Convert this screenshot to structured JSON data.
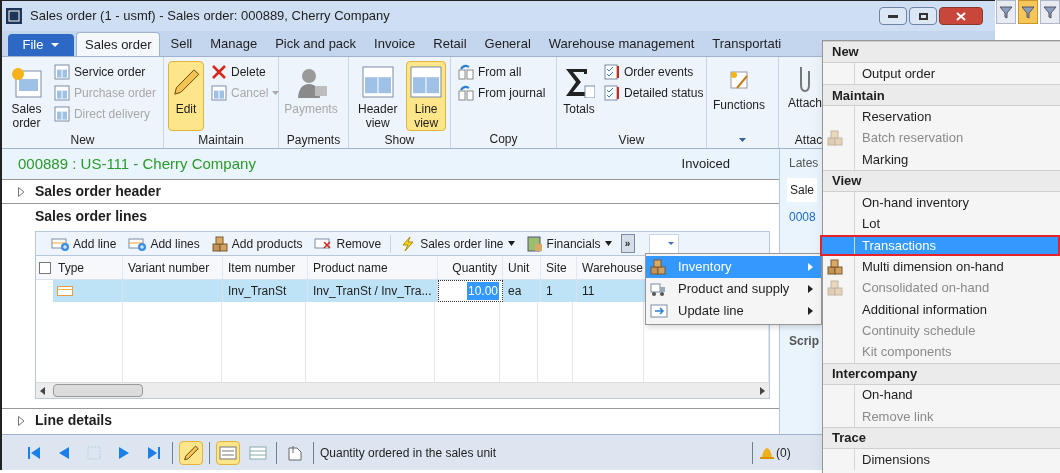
{
  "window": {
    "title": "Sales order (1 - usmf) - Sales order: 000889, Cherry Company"
  },
  "file_menu": {
    "label": "File"
  },
  "tabs": [
    {
      "label": "Sales order",
      "selected": true
    },
    {
      "label": "Sell",
      "selected": false
    },
    {
      "label": "Manage",
      "selected": false
    },
    {
      "label": "Pick and pack",
      "selected": false
    },
    {
      "label": "Invoice",
      "selected": false
    },
    {
      "label": "Retail",
      "selected": false
    },
    {
      "label": "General",
      "selected": false
    },
    {
      "label": "Warehouse management",
      "selected": false
    },
    {
      "label": "Transportati",
      "selected": false
    }
  ],
  "ribbon": [
    {
      "label": "New",
      "buttons": [
        {
          "label": "Sales order",
          "kind": "large",
          "disabled": false,
          "selected": false
        },
        {
          "label": "Service order",
          "kind": "small",
          "disabled": false,
          "selected": false
        },
        {
          "label": "Purchase order",
          "kind": "small",
          "disabled": true,
          "selected": false
        },
        {
          "label": "Direct delivery",
          "kind": "small",
          "disabled": true,
          "selected": false
        }
      ]
    },
    {
      "label": "Maintain",
      "buttons": [
        {
          "label": "Edit",
          "kind": "large",
          "disabled": false,
          "selected": true
        },
        {
          "label": "Delete",
          "kind": "small",
          "disabled": false,
          "selected": false
        },
        {
          "label": "Cancel",
          "kind": "small",
          "disabled": true,
          "selected": false,
          "dropdown": true
        }
      ]
    },
    {
      "label": "Payments",
      "buttons": [
        {
          "label": "Payments",
          "kind": "large",
          "disabled": true,
          "selected": false
        }
      ]
    },
    {
      "label": "Show",
      "buttons": [
        {
          "label": "Header view",
          "kind": "large",
          "disabled": false,
          "selected": false
        },
        {
          "label": "Line view",
          "kind": "large",
          "disabled": false,
          "selected": true
        }
      ]
    },
    {
      "label": "Copy",
      "buttons": [
        {
          "label": "From all",
          "kind": "small",
          "disabled": false,
          "selected": false
        },
        {
          "label": "From journal",
          "kind": "small",
          "disabled": false,
          "selected": false
        }
      ]
    },
    {
      "label": "View",
      "buttons": [
        {
          "label": "Totals",
          "kind": "large",
          "disabled": false,
          "selected": false
        },
        {
          "label": "Order events",
          "kind": "small",
          "disabled": false,
          "selected": false
        },
        {
          "label": "Detailed status",
          "kind": "small",
          "disabled": false,
          "selected": false
        }
      ]
    },
    {
      "launcher": true,
      "buttons": [
        {
          "label": "Functions",
          "kind": "large",
          "disabled": false,
          "selected": false
        }
      ]
    },
    {
      "label": "Attac",
      "buttons": [
        {
          "label": "Attach",
          "kind": "large",
          "disabled": false,
          "selected": false
        }
      ]
    }
  ],
  "record": {
    "title": "000889 : US-111 - Cherry Company",
    "status": "Invoiced"
  },
  "sections": [
    {
      "label": "Sales order header",
      "expanded": false
    },
    {
      "label": "Sales order lines"
    }
  ],
  "lines_toolbar": [
    {
      "label": "Add line",
      "dropdown": false
    },
    {
      "label": "Add lines",
      "dropdown": false
    },
    {
      "label": "Add products",
      "dropdown": false
    },
    {
      "label": "Remove",
      "dropdown": false
    },
    {
      "label": "Sales order line",
      "dropdown": true
    },
    {
      "label": "Financials",
      "dropdown": true
    }
  ],
  "overflow_button": {
    "label": "»"
  },
  "grid": {
    "select_all": false,
    "columns": [
      {
        "label": "Type",
        "kind": "text"
      },
      {
        "label": "Variant number",
        "kind": "text"
      },
      {
        "label": "Item number",
        "kind": "text"
      },
      {
        "label": "Product name",
        "kind": "text"
      },
      {
        "label": "Quantity",
        "kind": "number"
      },
      {
        "label": "Unit",
        "kind": "text"
      },
      {
        "label": "Site",
        "kind": "text"
      },
      {
        "label": "Warehouse",
        "kind": "text"
      }
    ],
    "rows": [
      {
        "selected": true,
        "cells": [
          "",
          "",
          "Inv_TranSt",
          "Inv_TranSt / Inv_Tra...",
          "10.00",
          "ea",
          "1",
          "11"
        ]
      }
    ]
  },
  "line_details": {
    "label": "Line details",
    "expanded": false
  },
  "factbox": {
    "texts": [
      "Lates",
      "Sale",
      "0008",
      "Scrip"
    ]
  },
  "status_bar": {
    "tools": [
      {
        "selected": false,
        "disabled": false
      },
      {
        "selected": false,
        "disabled": false
      },
      {
        "selected": false,
        "disabled": true
      },
      {
        "selected": false,
        "disabled": false
      },
      {
        "selected": false,
        "disabled": false
      },
      {
        "selected": true,
        "disabled": false
      },
      {
        "selected": true,
        "disabled": false
      },
      {
        "selected": false,
        "disabled": false
      },
      {
        "selected": false,
        "disabled": false
      }
    ],
    "message": "Quantity ordered in the sales unit",
    "alerts": "(0)"
  },
  "quick_tools": [
    {
      "selected": false
    },
    {
      "selected": true
    },
    {
      "selected": false
    }
  ],
  "submenu": [
    {
      "label": "Inventory",
      "selected": true,
      "has_submenu": true
    },
    {
      "label": "Product and supply",
      "selected": false,
      "has_submenu": true
    },
    {
      "label": "Update line",
      "selected": false,
      "has_submenu": true
    }
  ],
  "menu": [
    {
      "label": "New",
      "items": [
        {
          "label": "Output order",
          "disabled": false,
          "selected": false
        }
      ]
    },
    {
      "label": "Maintain",
      "items": [
        {
          "label": "Reservation",
          "disabled": false,
          "selected": false
        },
        {
          "label": "Batch reservation",
          "disabled": true,
          "selected": false
        },
        {
          "label": "Marking",
          "disabled": false,
          "selected": false
        }
      ]
    },
    {
      "label": "View",
      "items": [
        {
          "label": "On-hand inventory",
          "disabled": false,
          "selected": false
        },
        {
          "label": "Lot",
          "disabled": false,
          "selected": false
        },
        {
          "label": "Transactions",
          "disabled": false,
          "selected": true
        },
        {
          "label": "Multi dimension on-hand",
          "disabled": false,
          "selected": false
        },
        {
          "label": "Consolidated on-hand",
          "disabled": true,
          "selected": false
        },
        {
          "label": "Additional information",
          "disabled": false,
          "selected": false
        },
        {
          "label": "Continuity schedule",
          "disabled": true,
          "selected": false
        },
        {
          "label": "Kit components",
          "disabled": true,
          "selected": false
        }
      ]
    },
    {
      "label": "Intercompany",
      "items": [
        {
          "label": "On-hand",
          "disabled": false,
          "selected": false
        },
        {
          "label": "Remove link",
          "disabled": true,
          "selected": false
        }
      ]
    },
    {
      "label": "Trace",
      "items": [
        {
          "label": "Dimensions",
          "disabled": false,
          "selected": false
        }
      ]
    }
  ]
}
